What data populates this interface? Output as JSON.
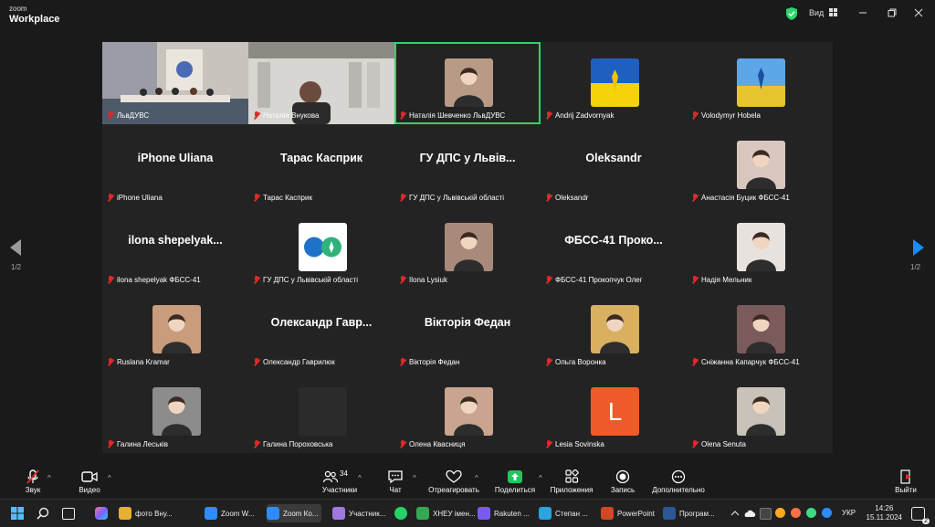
{
  "app": {
    "brand_small": "zoom",
    "brand_big": "Workplace",
    "view_label": "Вид"
  },
  "pager": {
    "left": "1/2",
    "right": "1/2"
  },
  "participants": [
    {
      "name": "ЛьвДУВС",
      "type": "video1"
    },
    {
      "name": "Наталія Внукова",
      "type": "video2"
    },
    {
      "name": "Наталія Шевченко ЛьвДУВС",
      "type": "avatar",
      "color": "#b89a86",
      "active": true
    },
    {
      "name": "Andrij Zadvornyak",
      "type": "flag"
    },
    {
      "name": "Volodymyr Hobela",
      "type": "field"
    },
    {
      "name": "iPhone Uliana",
      "type": "text",
      "display": "iPhone Uliana"
    },
    {
      "name": "Тарас Касприк",
      "type": "text",
      "display": "Тарас Касприк"
    },
    {
      "name": "ГУ ДПС у Львівській області",
      "type": "text",
      "display": "ГУ ДПС у Львів..."
    },
    {
      "name": "Oleksandr",
      "type": "text",
      "display": "Oleksandr"
    },
    {
      "name": "Анастасія Буцик ФБСС-41",
      "type": "avatar",
      "color": "#d9c7bf"
    },
    {
      "name": "ilona shepelyak ФБСС-41",
      "type": "text",
      "display": "ilona  shepelyak..."
    },
    {
      "name": "ГУ ДПС у Львівській області",
      "type": "logo"
    },
    {
      "name": "Ilona Lysiuk",
      "type": "avatar",
      "color": "#a88a7a"
    },
    {
      "name": "ФБСС-41 Прокопчук Олег",
      "type": "text",
      "display": "ФБСС-41  Проко..."
    },
    {
      "name": "Надія Мельник",
      "type": "avatar",
      "color": "#e8e2df"
    },
    {
      "name": "Ruslana Kramar",
      "type": "avatar",
      "color": "#c99c7c"
    },
    {
      "name": "Олександр Гаврилюк",
      "type": "text",
      "display": "Олександр  Гавр..."
    },
    {
      "name": "Вікторія Федан",
      "type": "text",
      "display": "Вікторія Федан"
    },
    {
      "name": "Ольга Воронка",
      "type": "avatar",
      "color": "#d8b060"
    },
    {
      "name": "Сніжанна Капарчук ФБСС-41",
      "type": "avatar",
      "color": "#7a5a5a"
    },
    {
      "name": "Галина Леськів",
      "type": "avatar",
      "color": "#8c8c8c"
    },
    {
      "name": "Галина Пороховська",
      "type": "blank"
    },
    {
      "name": "Олена Квасниця",
      "type": "avatar",
      "color": "#c9a48e"
    },
    {
      "name": "Lesia Sovinska",
      "type": "letter",
      "letter": "L",
      "color": "#f05a28"
    },
    {
      "name": "Olena Senuta",
      "type": "avatar",
      "color": "#c8c2b8"
    }
  ],
  "toolbar": {
    "audio": "Звук",
    "video": "Видео",
    "participants": "Участники",
    "participants_count": "34",
    "chat": "Чат",
    "react": "Отреагировать",
    "share": "Поделиться",
    "apps": "Приложения",
    "record": "Запись",
    "more": "Дополнительно",
    "leave": "Выйти"
  },
  "taskbar": {
    "items": [
      {
        "label": "фото Вну...",
        "color": "#e8b030"
      },
      {
        "label": "Zoom W...",
        "color": "#2d8cff"
      },
      {
        "label": "Zoom Ко...",
        "color": "#2d8cff"
      },
      {
        "label": "Участник...",
        "color": "#a078e0"
      },
      {
        "label": "ХНЕУ імен...",
        "color": "#34a853"
      },
      {
        "label": "Rakuten ...",
        "color": "#7a5af0"
      },
      {
        "label": "Степан ...",
        "color": "#2aa3de"
      },
      {
        "label": "PowerPoint",
        "color": "#d24726"
      },
      {
        "label": "Програм...",
        "color": "#2b5797"
      }
    ],
    "lang": "УКР",
    "time": "14:26",
    "date": "15.11.2024",
    "notif_count": "2"
  },
  "colors": {
    "accent_green": "#2fd46a",
    "mute_red": "#e02828",
    "share_green": "#22c55e",
    "leave_red": "#e02828"
  }
}
